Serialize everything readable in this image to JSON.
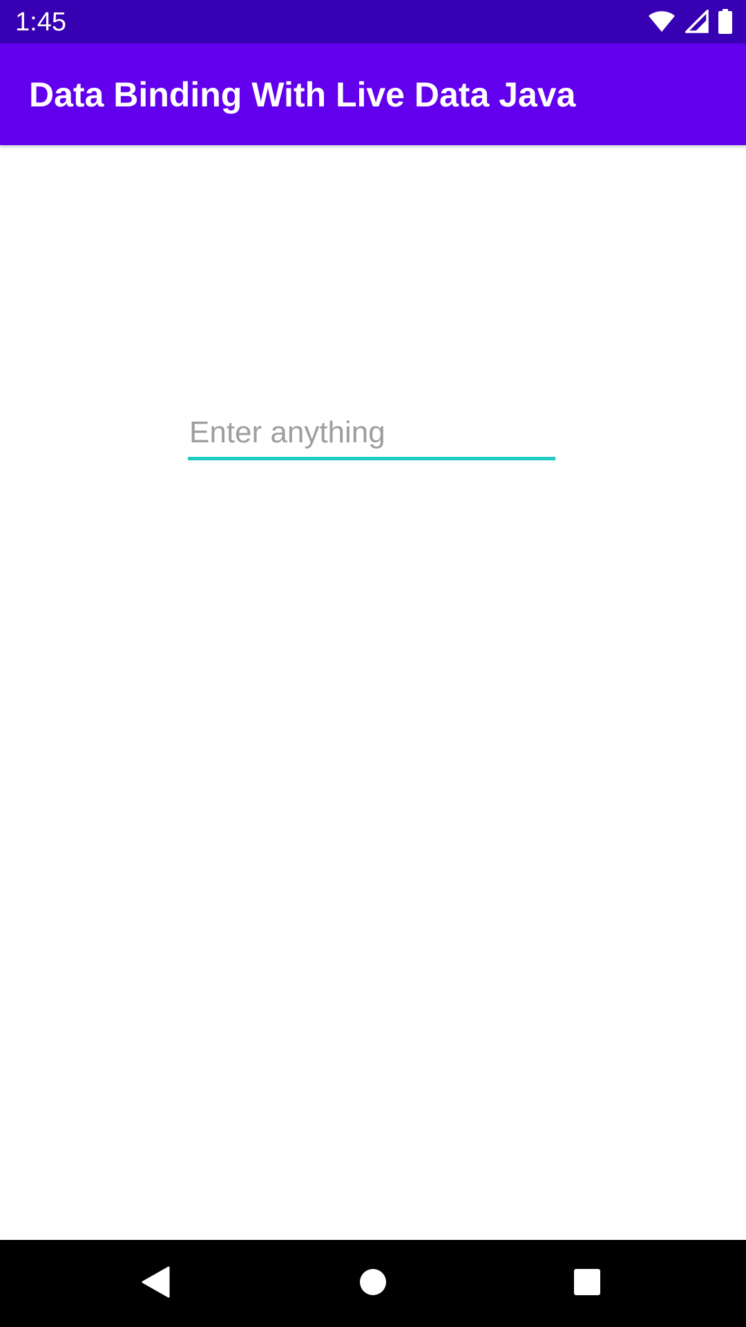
{
  "status_bar": {
    "time": "1:45",
    "icons": [
      "wifi-icon",
      "cellular-signal-icon",
      "battery-icon"
    ],
    "background": "#3700b3"
  },
  "app_bar": {
    "title": "Data Binding With Live Data Java",
    "background": "#6200ee"
  },
  "main": {
    "input": {
      "value": "",
      "placeholder": "Enter anything",
      "underline_color": "#1ecbc0"
    }
  },
  "nav_bar": {
    "buttons": [
      "back-icon",
      "home-icon",
      "recents-icon"
    ]
  }
}
